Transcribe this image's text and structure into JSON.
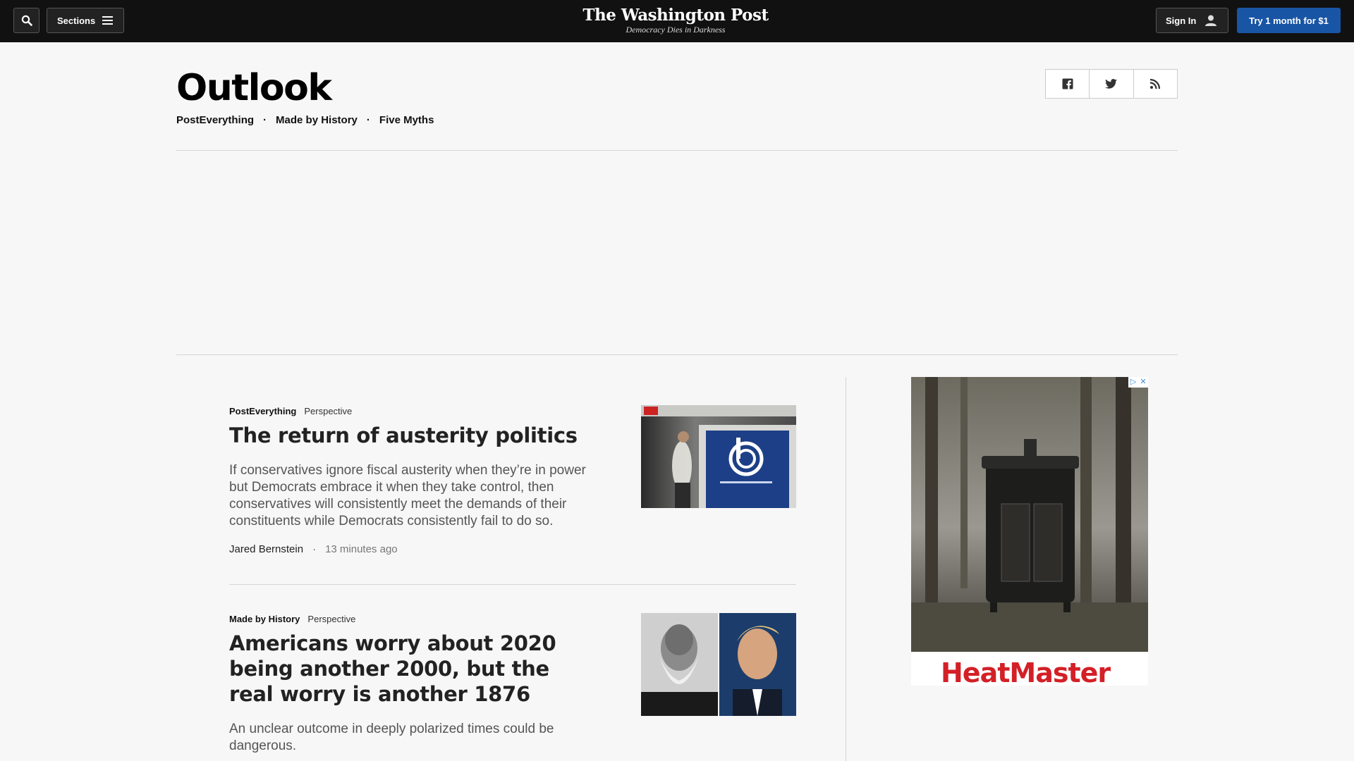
{
  "topbar": {
    "sections_label": "Sections",
    "masthead": "The Washington Post",
    "tagline": "Democracy Dies in Darkness",
    "signin_label": "Sign In",
    "subscribe_label": "Try 1 month for $1"
  },
  "page": {
    "title": "Outlook",
    "subnav": [
      "PostEverything",
      "Made by History",
      "Five Myths"
    ],
    "share": [
      "facebook-icon",
      "twitter-icon",
      "rss-icon"
    ]
  },
  "stories": [
    {
      "section": "PostEverything",
      "label": "Perspective",
      "headline": "The return of austerity politics",
      "blurb": "If conservatives ignore fiscal austerity when they’re in power but Democrats embrace it when they take control, then conservatives will consistently meet the demands of their constituents while Democrats consistently fail to do so.",
      "author": "Jared Bernstein",
      "time": "13 minutes ago"
    },
    {
      "section": "Made by History",
      "label": "Perspective",
      "headline": "Americans worry about 2020 being another 2000, but the real worry is another 1876",
      "blurb": "An unclear outcome in deeply polarized times could be dangerous."
    }
  ],
  "ad": {
    "brand": "HeatMaster",
    "choices": [
      "▷",
      "✕"
    ]
  },
  "colors": {
    "topbar": "#111111",
    "subscribe": "#1955a5",
    "background": "#f7f7f7",
    "ad_brand": "#d32027"
  }
}
